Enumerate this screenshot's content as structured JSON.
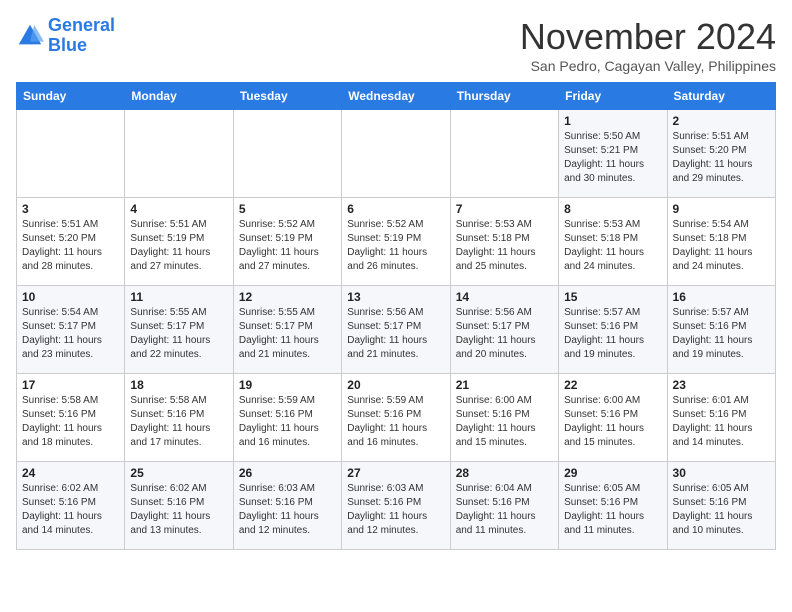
{
  "header": {
    "logo_line1": "General",
    "logo_line2": "Blue",
    "month": "November 2024",
    "location": "San Pedro, Cagayan Valley, Philippines"
  },
  "weekdays": [
    "Sunday",
    "Monday",
    "Tuesday",
    "Wednesday",
    "Thursday",
    "Friday",
    "Saturday"
  ],
  "weeks": [
    [
      {
        "day": "",
        "info": ""
      },
      {
        "day": "",
        "info": ""
      },
      {
        "day": "",
        "info": ""
      },
      {
        "day": "",
        "info": ""
      },
      {
        "day": "",
        "info": ""
      },
      {
        "day": "1",
        "info": "Sunrise: 5:50 AM\nSunset: 5:21 PM\nDaylight: 11 hours and 30 minutes."
      },
      {
        "day": "2",
        "info": "Sunrise: 5:51 AM\nSunset: 5:20 PM\nDaylight: 11 hours and 29 minutes."
      }
    ],
    [
      {
        "day": "3",
        "info": "Sunrise: 5:51 AM\nSunset: 5:20 PM\nDaylight: 11 hours and 28 minutes."
      },
      {
        "day": "4",
        "info": "Sunrise: 5:51 AM\nSunset: 5:19 PM\nDaylight: 11 hours and 27 minutes."
      },
      {
        "day": "5",
        "info": "Sunrise: 5:52 AM\nSunset: 5:19 PM\nDaylight: 11 hours and 27 minutes."
      },
      {
        "day": "6",
        "info": "Sunrise: 5:52 AM\nSunset: 5:19 PM\nDaylight: 11 hours and 26 minutes."
      },
      {
        "day": "7",
        "info": "Sunrise: 5:53 AM\nSunset: 5:18 PM\nDaylight: 11 hours and 25 minutes."
      },
      {
        "day": "8",
        "info": "Sunrise: 5:53 AM\nSunset: 5:18 PM\nDaylight: 11 hours and 24 minutes."
      },
      {
        "day": "9",
        "info": "Sunrise: 5:54 AM\nSunset: 5:18 PM\nDaylight: 11 hours and 24 minutes."
      }
    ],
    [
      {
        "day": "10",
        "info": "Sunrise: 5:54 AM\nSunset: 5:17 PM\nDaylight: 11 hours and 23 minutes."
      },
      {
        "day": "11",
        "info": "Sunrise: 5:55 AM\nSunset: 5:17 PM\nDaylight: 11 hours and 22 minutes."
      },
      {
        "day": "12",
        "info": "Sunrise: 5:55 AM\nSunset: 5:17 PM\nDaylight: 11 hours and 21 minutes."
      },
      {
        "day": "13",
        "info": "Sunrise: 5:56 AM\nSunset: 5:17 PM\nDaylight: 11 hours and 21 minutes."
      },
      {
        "day": "14",
        "info": "Sunrise: 5:56 AM\nSunset: 5:17 PM\nDaylight: 11 hours and 20 minutes."
      },
      {
        "day": "15",
        "info": "Sunrise: 5:57 AM\nSunset: 5:16 PM\nDaylight: 11 hours and 19 minutes."
      },
      {
        "day": "16",
        "info": "Sunrise: 5:57 AM\nSunset: 5:16 PM\nDaylight: 11 hours and 19 minutes."
      }
    ],
    [
      {
        "day": "17",
        "info": "Sunrise: 5:58 AM\nSunset: 5:16 PM\nDaylight: 11 hours and 18 minutes."
      },
      {
        "day": "18",
        "info": "Sunrise: 5:58 AM\nSunset: 5:16 PM\nDaylight: 11 hours and 17 minutes."
      },
      {
        "day": "19",
        "info": "Sunrise: 5:59 AM\nSunset: 5:16 PM\nDaylight: 11 hours and 16 minutes."
      },
      {
        "day": "20",
        "info": "Sunrise: 5:59 AM\nSunset: 5:16 PM\nDaylight: 11 hours and 16 minutes."
      },
      {
        "day": "21",
        "info": "Sunrise: 6:00 AM\nSunset: 5:16 PM\nDaylight: 11 hours and 15 minutes."
      },
      {
        "day": "22",
        "info": "Sunrise: 6:00 AM\nSunset: 5:16 PM\nDaylight: 11 hours and 15 minutes."
      },
      {
        "day": "23",
        "info": "Sunrise: 6:01 AM\nSunset: 5:16 PM\nDaylight: 11 hours and 14 minutes."
      }
    ],
    [
      {
        "day": "24",
        "info": "Sunrise: 6:02 AM\nSunset: 5:16 PM\nDaylight: 11 hours and 14 minutes."
      },
      {
        "day": "25",
        "info": "Sunrise: 6:02 AM\nSunset: 5:16 PM\nDaylight: 11 hours and 13 minutes."
      },
      {
        "day": "26",
        "info": "Sunrise: 6:03 AM\nSunset: 5:16 PM\nDaylight: 11 hours and 12 minutes."
      },
      {
        "day": "27",
        "info": "Sunrise: 6:03 AM\nSunset: 5:16 PM\nDaylight: 11 hours and 12 minutes."
      },
      {
        "day": "28",
        "info": "Sunrise: 6:04 AM\nSunset: 5:16 PM\nDaylight: 11 hours and 11 minutes."
      },
      {
        "day": "29",
        "info": "Sunrise: 6:05 AM\nSunset: 5:16 PM\nDaylight: 11 hours and 11 minutes."
      },
      {
        "day": "30",
        "info": "Sunrise: 6:05 AM\nSunset: 5:16 PM\nDaylight: 11 hours and 10 minutes."
      }
    ]
  ]
}
